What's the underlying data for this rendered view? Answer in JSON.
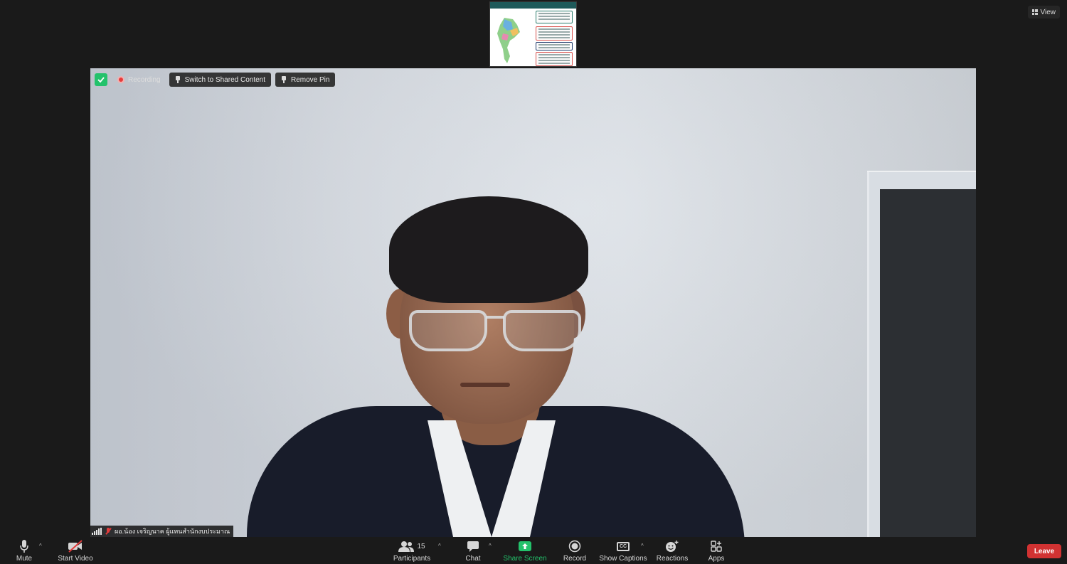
{
  "top": {
    "view_label": "View"
  },
  "video": {
    "recording_label": "Recording",
    "switch_label": "Switch to Shared Content",
    "remove_pin_label": "Remove Pin",
    "participant_name": "ผอ.น้อง  เจริญนาค ผู้แทนสำนักงบประมาณ"
  },
  "toolbar": {
    "mute_label": "Mute",
    "start_video_label": "Start Video",
    "participants_label": "Participants",
    "participants_count": "15",
    "chat_label": "Chat",
    "share_label": "Share Screen",
    "record_label": "Record",
    "captions_label": "Show Captions",
    "captions_icon_text": "CC",
    "reactions_label": "Reactions",
    "apps_label": "Apps",
    "leave_label": "Leave"
  },
  "colors": {
    "accent_green": "#23c26b",
    "leave_red": "#d13232",
    "recording_red": "#e63b3b"
  }
}
